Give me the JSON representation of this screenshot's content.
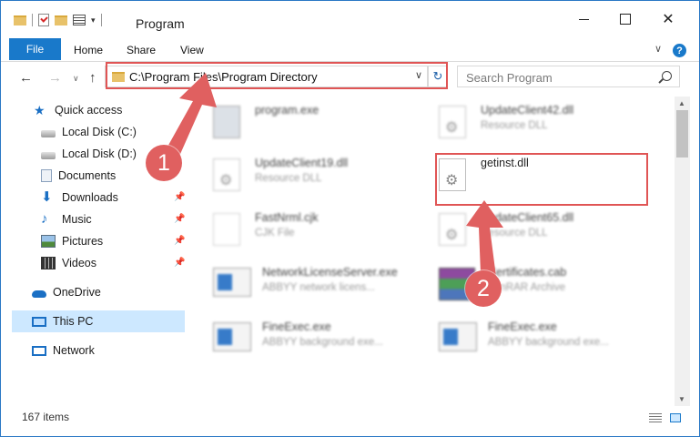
{
  "window": {
    "title": "Program",
    "controls": {
      "minimize": "minimize",
      "maximize": "maximize",
      "close": "✕"
    }
  },
  "ribbon": {
    "tabs": [
      "File",
      "Home",
      "Share",
      "View"
    ],
    "help": "?"
  },
  "address_bar": {
    "path": "C:\\Program Files\\Program Directory",
    "search_placeholder": "Search Program"
  },
  "sidebar": {
    "items": [
      {
        "label": "Quick access",
        "icon": "star-icon"
      },
      {
        "label": "Local Disk (C:)",
        "icon": "drive-icon"
      },
      {
        "label": "Local Disk (D:)",
        "icon": "drive-icon"
      },
      {
        "label": "Documents",
        "icon": "documents-icon"
      },
      {
        "label": "Downloads",
        "icon": "download-icon"
      },
      {
        "label": "Music",
        "icon": "music-icon"
      },
      {
        "label": "Pictures",
        "icon": "pictures-icon"
      },
      {
        "label": "Videos",
        "icon": "videos-icon"
      },
      {
        "label": "OneDrive",
        "icon": "cloud-icon"
      },
      {
        "label": "This PC",
        "icon": "computer-icon"
      },
      {
        "label": "Network",
        "icon": "network-icon"
      }
    ],
    "selected": "This PC"
  },
  "files": [
    {
      "name": "program.exe",
      "type": ""
    },
    {
      "name": "UpdateClient42.dll",
      "type": "Resource DLL"
    },
    {
      "name": "UpdateClient19.dll",
      "type": "Resource DLL"
    },
    {
      "name": "getinst.dll",
      "type": ""
    },
    {
      "name": "FastNrml.cjk",
      "type": "CJK File"
    },
    {
      "name": "UpdateClient65.dll",
      "type": "Resource DLL"
    },
    {
      "name": "NetworkLicenseServer.exe",
      "type": "ABBYY network licens..."
    },
    {
      "name": "Certificates.cab",
      "type": "WinRAR Archive"
    },
    {
      "name": "FineExec.exe",
      "type": "ABBYY background exe..."
    },
    {
      "name": "FineExec.exe",
      "type": "ABBYY background exe..."
    }
  ],
  "status": {
    "item_count": "167 items"
  },
  "annotations": {
    "step1": "1",
    "step2": "2"
  },
  "colors": {
    "accent": "#1979ca",
    "annotation": "#e05555"
  }
}
